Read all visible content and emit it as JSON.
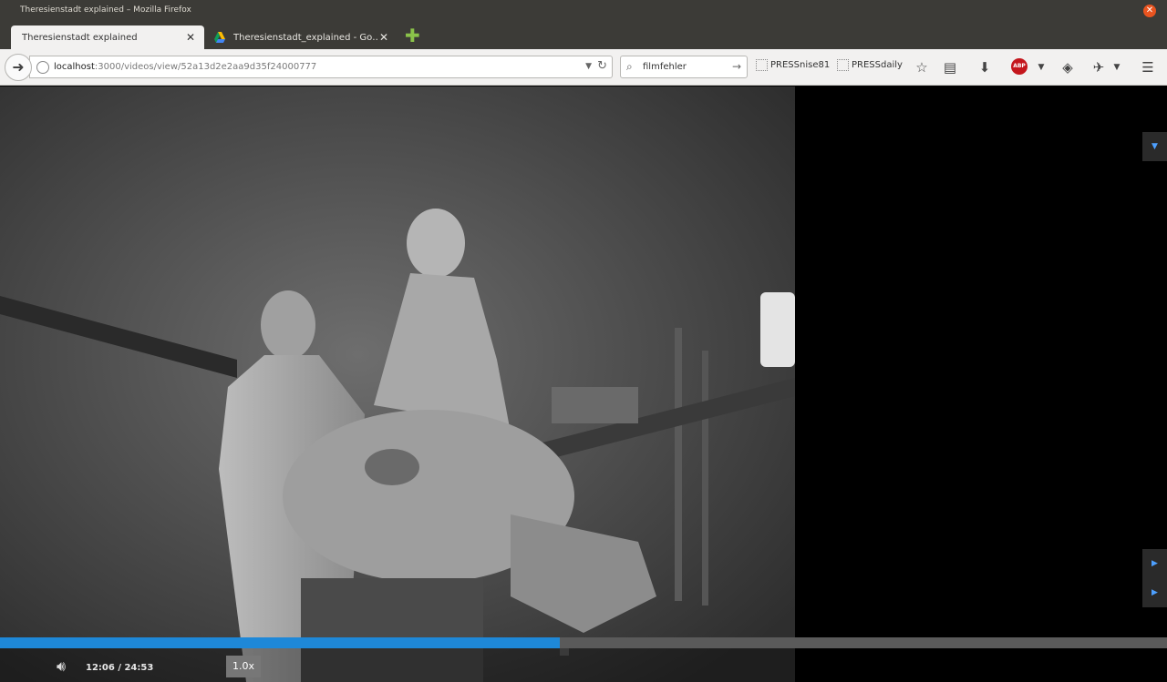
{
  "window": {
    "title": "Theresienstadt explained – Mozilla Firefox"
  },
  "tabs": [
    {
      "label": "Theresienstadt explained"
    },
    {
      "label": "Theresienstadt_explained - Go…"
    }
  ],
  "navbar": {
    "url_host": "localhost",
    "url_path": ":3000/videos/view/52a13d2e2aa9d35f24000777",
    "search_value": "filmfehler",
    "bookmarks": [
      "PRESSnise81",
      "PRESSdaily"
    ],
    "adblock_label": "ABP"
  },
  "player": {
    "time": "12:06 / 24:53",
    "speed": "1.0x",
    "progress": 0.48
  },
  "colors": {
    "progress_fill": "#1e88d8",
    "accent_close": "#e95420"
  }
}
